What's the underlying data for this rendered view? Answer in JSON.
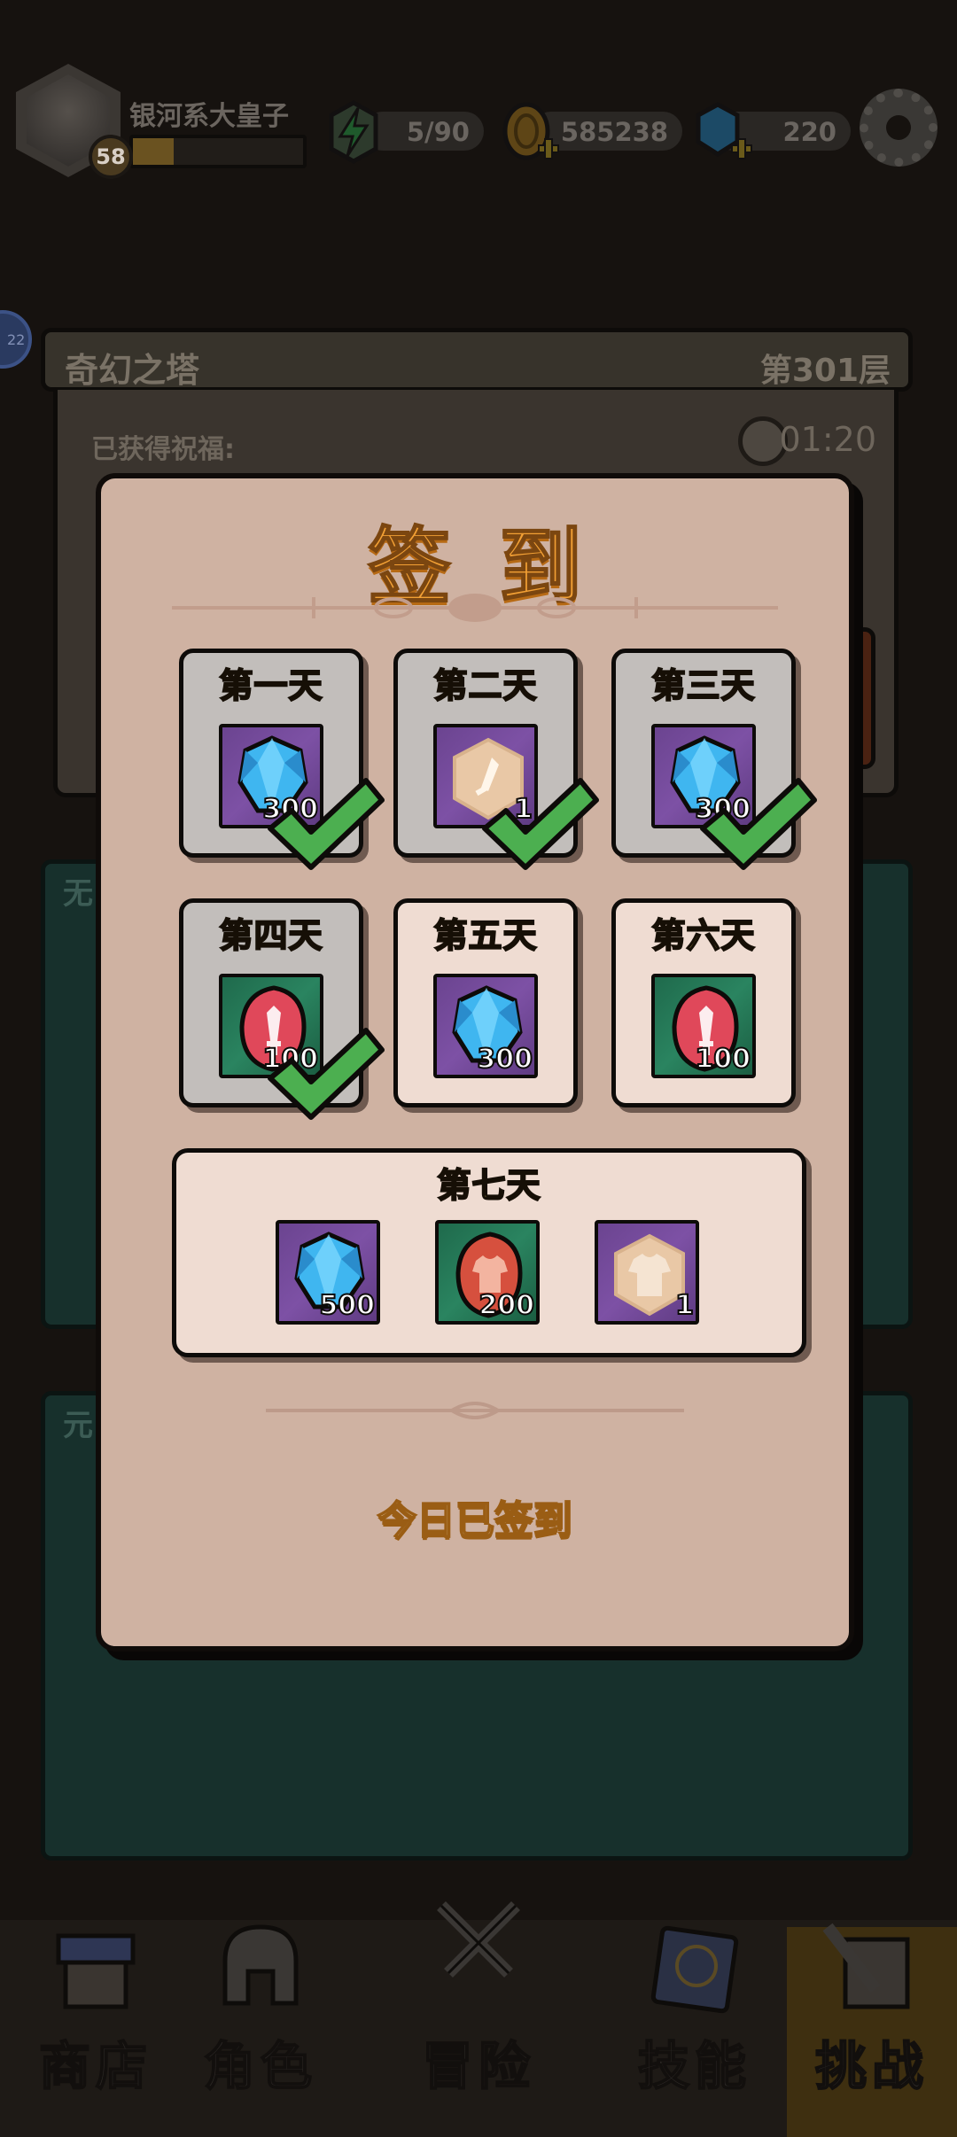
{
  "player": {
    "name": "银河系大皇子",
    "level": "58",
    "xp_fraction": 0.24
  },
  "resources": {
    "energy": "5/90",
    "coins": "585238",
    "gems": "220"
  },
  "side_badge": "22",
  "background_panel": {
    "title": "奇幻之塔",
    "floor": "第301层",
    "blessing_label": "已获得祝福:",
    "timer": "01:20",
    "section_tab_1": "无",
    "section_tab_2": "元"
  },
  "nav": [
    {
      "label": "商店",
      "icon": "shop-icon"
    },
    {
      "label": "角色",
      "icon": "helmet-icon"
    },
    {
      "label": "冒险",
      "icon": "crossed-swords-icon"
    },
    {
      "label": "技能",
      "icon": "spellbook-icon"
    },
    {
      "label": "挑战",
      "icon": "sword-scroll-icon"
    }
  ],
  "signin": {
    "title": "签到",
    "status": "今日已签到",
    "days": [
      {
        "label": "第一天",
        "reward": "gem",
        "amount": "300",
        "claimed": true
      },
      {
        "label": "第二天",
        "reward": "weapon-scroll",
        "amount": "1",
        "claimed": true
      },
      {
        "label": "第三天",
        "reward": "gem",
        "amount": "300",
        "claimed": true
      },
      {
        "label": "第四天",
        "reward": "weapon-stone",
        "amount": "100",
        "claimed": true
      },
      {
        "label": "第五天",
        "reward": "gem",
        "amount": "300",
        "claimed": false
      },
      {
        "label": "第六天",
        "reward": "weapon-stone",
        "amount": "100",
        "claimed": false
      }
    ],
    "day7": {
      "label": "第七天",
      "rewards": [
        {
          "reward": "gem",
          "amount": "500"
        },
        {
          "reward": "armor-stone",
          "amount": "200"
        },
        {
          "reward": "armor-scroll",
          "amount": "1"
        }
      ]
    }
  },
  "colors": {
    "modal_bg": "#cfb2a2",
    "title": "#f2a035",
    "day_label": "#ffe26a",
    "check": "#4caf50",
    "gem": "#3fb6f0"
  }
}
